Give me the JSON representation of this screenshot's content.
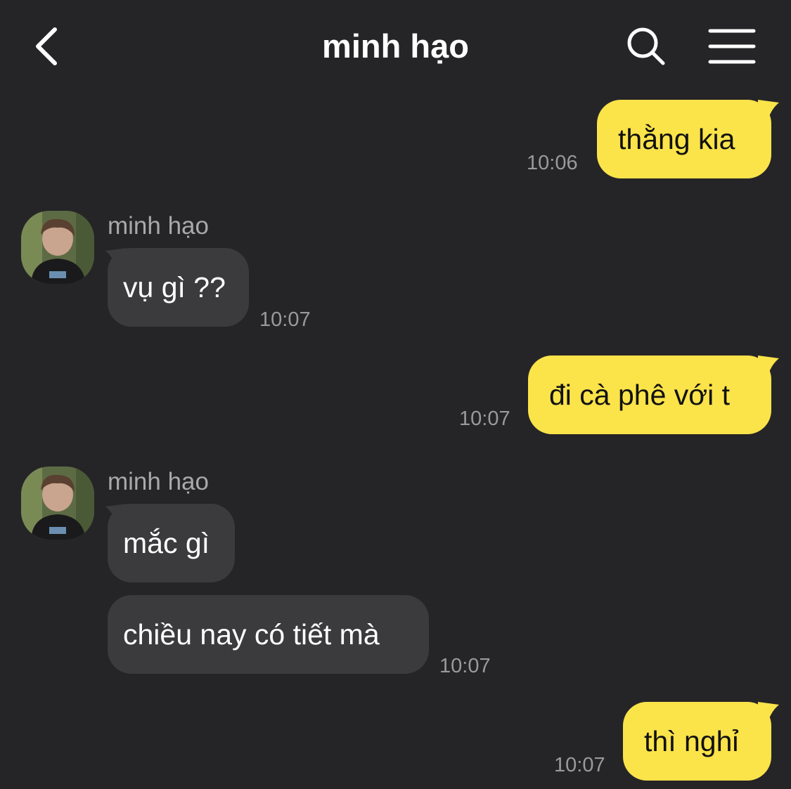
{
  "header": {
    "title": "minh hạo",
    "back_icon": "chevron-left-icon",
    "search_icon": "search-icon",
    "menu_icon": "hamburger-menu-icon"
  },
  "colors": {
    "background": "#252527",
    "outgoing_bubble": "#fbe34a",
    "incoming_bubble": "#3b3b3d",
    "timestamp": "#9a9a9c"
  },
  "messages": [
    {
      "direction": "out",
      "text": "thằng kia",
      "time": "10:06"
    },
    {
      "direction": "in",
      "sender": "minh hạo",
      "text": "vụ gì ??",
      "time": "10:07"
    },
    {
      "direction": "out",
      "text": "đi cà phê với t",
      "time": "10:07"
    },
    {
      "direction": "in",
      "sender": "minh hạo",
      "text": "mắc gì"
    },
    {
      "direction": "in",
      "text": "chiều nay có tiết mà",
      "time": "10:07"
    },
    {
      "direction": "out",
      "text": "thì nghỉ",
      "time": "10:07"
    }
  ]
}
